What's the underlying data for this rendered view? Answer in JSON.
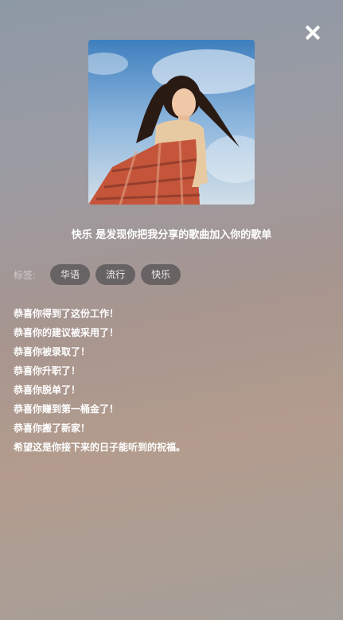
{
  "close": {
    "icon": "close-icon"
  },
  "cover": {
    "alt": "song cover photo"
  },
  "title": "快乐 是发现你把我分享的歌曲加入你的歌单",
  "tags": {
    "label": "标签:",
    "items": [
      {
        "label": "华语"
      },
      {
        "label": "流行"
      },
      {
        "label": "快乐"
      }
    ]
  },
  "description": [
    "恭喜你得到了这份工作！",
    "恭喜你的建议被采用了！",
    "恭喜你被录取了！",
    "恭喜你升职了！",
    "恭喜你脱单了！",
    "恭喜你赚到第一桶金了！",
    "恭喜你搬了新家！",
    "希望这是你接下来的日子能听到的祝福。"
  ]
}
